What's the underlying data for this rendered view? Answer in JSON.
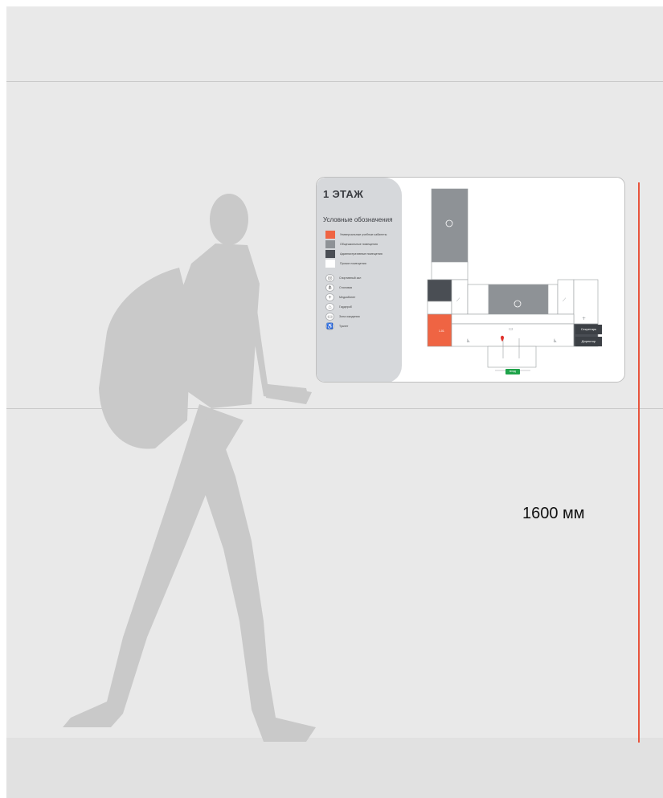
{
  "measurement": {
    "label": "1600 мм",
    "color": "#e8543c"
  },
  "sign": {
    "floor_title": "1 ЭТАЖ",
    "legend_title": "Условные обозначения",
    "color_legend": [
      {
        "label": "Универсальные учебные кабинеты",
        "color": "#ef6443"
      },
      {
        "label": "Общешкольные помещения",
        "color": "#8e9296"
      },
      {
        "label": "Административные помещения",
        "color": "#4a4e54"
      },
      {
        "label": "Прочие помещения",
        "color": "#ffffff"
      }
    ],
    "icon_legend": [
      {
        "label": "Спортивный зал",
        "icon": "ball-icon"
      },
      {
        "label": "Столовая",
        "icon": "dining-icon"
      },
      {
        "label": "Медкабинет",
        "icon": "medical-icon"
      },
      {
        "label": "Гардероб",
        "icon": "wardrobe-icon"
      },
      {
        "label": "Зона ожидания",
        "icon": "sofa-icon"
      },
      {
        "label": "Туалет",
        "icon": "toilet-icon"
      }
    ],
    "map_labels": {
      "secretary": "Секретарь",
      "director": "Директор",
      "entrance": "вход"
    }
  }
}
